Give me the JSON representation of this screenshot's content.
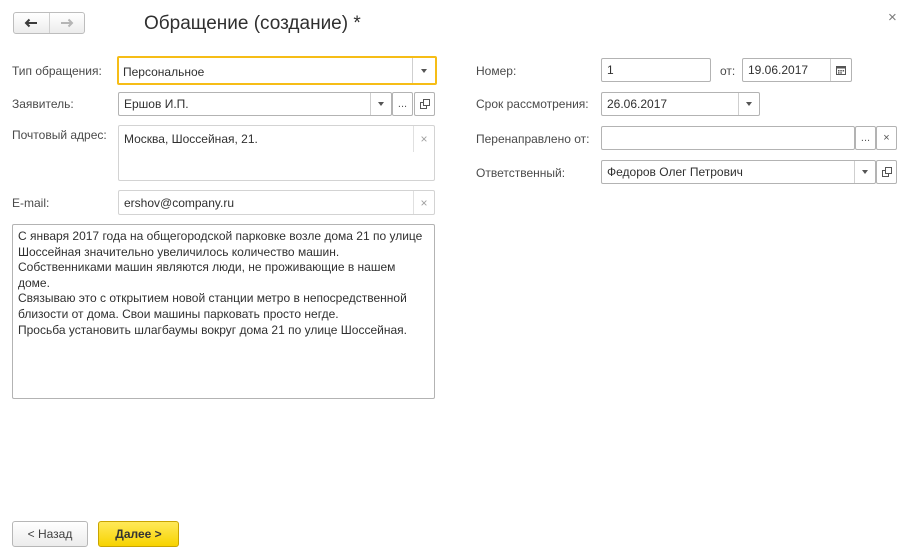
{
  "window": {
    "title": "Обращение (создание) *",
    "close_label": "×"
  },
  "form": {
    "type": {
      "label": "Тип обращения:",
      "value": "Персональное"
    },
    "applicant": {
      "label": "Заявитель:",
      "value": "Ершов И.П.",
      "more_label": "..."
    },
    "address": {
      "label": "Почтовый адрес:",
      "value": "Москва, Шоссейная, 21."
    },
    "email": {
      "label": "E-mail:",
      "value": "ershov@company.ru"
    },
    "message": "С января 2017 года на общегородской парковке возле дома 21 по улице Шоссейная значительно увеличилось количество машин. Собственниками машин являются люди, не проживающие в нашем доме.\nСвязываю это с открытием новой станции метро в непосредственной близости от дома. Свои машины парковать просто негде.\nПросьба установить шлагбаумы вокруг дома 21 по улице Шоссейная.",
    "number": {
      "label": "Номер:",
      "value": "1"
    },
    "date": {
      "label": "от:",
      "value": "19.06.2017"
    },
    "deadline": {
      "label": "Срок рассмотрения:",
      "value": "26.06.2017"
    },
    "redirected": {
      "label": "Перенаправлено от:",
      "value": "",
      "more_label": "...",
      "clear_label": "×"
    },
    "responsible": {
      "label": "Ответственный:",
      "value": "Федоров Олег Петрович"
    }
  },
  "footer": {
    "back_label": "< Назад",
    "next_label": "Далее >"
  },
  "colors": {
    "focus": "#f6bd16",
    "primary_button": "#f7d300"
  }
}
